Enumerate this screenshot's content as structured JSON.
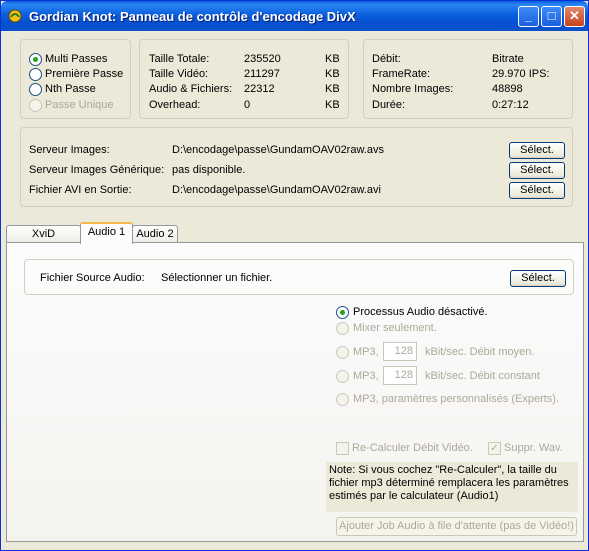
{
  "window": {
    "title": "Gordian Knot:  Panneau de contrôle d'encodage DivX",
    "minimize_glyph": "_",
    "maximize_glyph": "□",
    "close_glyph": "✕"
  },
  "passes": {
    "options": [
      "Multi Passes",
      "Première Passe",
      "Nth Passe",
      "Passe Unique"
    ],
    "selected": "Multi Passes",
    "disabled": [
      "Passe Unique"
    ]
  },
  "sizes": {
    "rows": [
      {
        "label": "Taille Totale:",
        "value": "235520",
        "unit": "KB"
      },
      {
        "label": "Taille Vidéo:",
        "value": "211297",
        "unit": "KB"
      },
      {
        "label": "Audio & Fichiers:",
        "value": "22312",
        "unit": "KB"
      },
      {
        "label": "Overhead:",
        "value": "0",
        "unit": "KB"
      }
    ]
  },
  "info": {
    "rows": [
      {
        "label": "Débit:",
        "value": "Bitrate"
      },
      {
        "label": "FrameRate:",
        "value": "29.970 IPS:"
      },
      {
        "label": "Nombre Images:",
        "value": "48898"
      },
      {
        "label": "Durée:",
        "value": "0:27:12"
      }
    ]
  },
  "files": {
    "rows": [
      {
        "label": "Serveur Images:",
        "value": "D:\\encodage\\passe\\GundamOAV02raw.avs",
        "button": "Sélect."
      },
      {
        "label": "Serveur Images Générique:",
        "value": "pas disponible.",
        "button": "Sélect."
      },
      {
        "label": "Fichier AVI en Sortie:",
        "value": "D:\\encodage\\passe\\GundamOAV02raw.avi",
        "button": "Sélect."
      }
    ]
  },
  "tabs": [
    "XviD",
    "Audio 1",
    "Audio 2"
  ],
  "active_tab": "Audio 1",
  "audio": {
    "source_label": "Fichier Source Audio:",
    "source_value": "Sélectionner un fichier.",
    "source_button": "Sélect.",
    "process_options": [
      {
        "label": "Processus Audio désactivé.",
        "selected": true,
        "enabled": true
      },
      {
        "label": "Mixer seulement.",
        "selected": false,
        "enabled": false
      },
      {
        "label": "MP3,",
        "selected": false,
        "enabled": false,
        "value": "128",
        "suffix": "kBit/sec. Débit moyen."
      },
      {
        "label": "MP3,",
        "selected": false,
        "enabled": false,
        "value": "128",
        "suffix": "kBit/sec. Débit constant"
      },
      {
        "label": "MP3, paramètres personnalisés (Experts).",
        "selected": false,
        "enabled": false
      }
    ],
    "recalc_label": "Re-Calculer Débit Vidéo.",
    "recalc_checked": false,
    "suppr_label": "Suppr. Wav.",
    "suppr_checked": true,
    "note": "Note: Si vous cochez \"Re-Calculer\", la taille du fichier mp3 déterminé remplacera les paramètres estimés par le calculateur (Audio1)",
    "add_job_button": "Ajouter Job Audio à file d'attente (pas de Vidéo!)"
  }
}
